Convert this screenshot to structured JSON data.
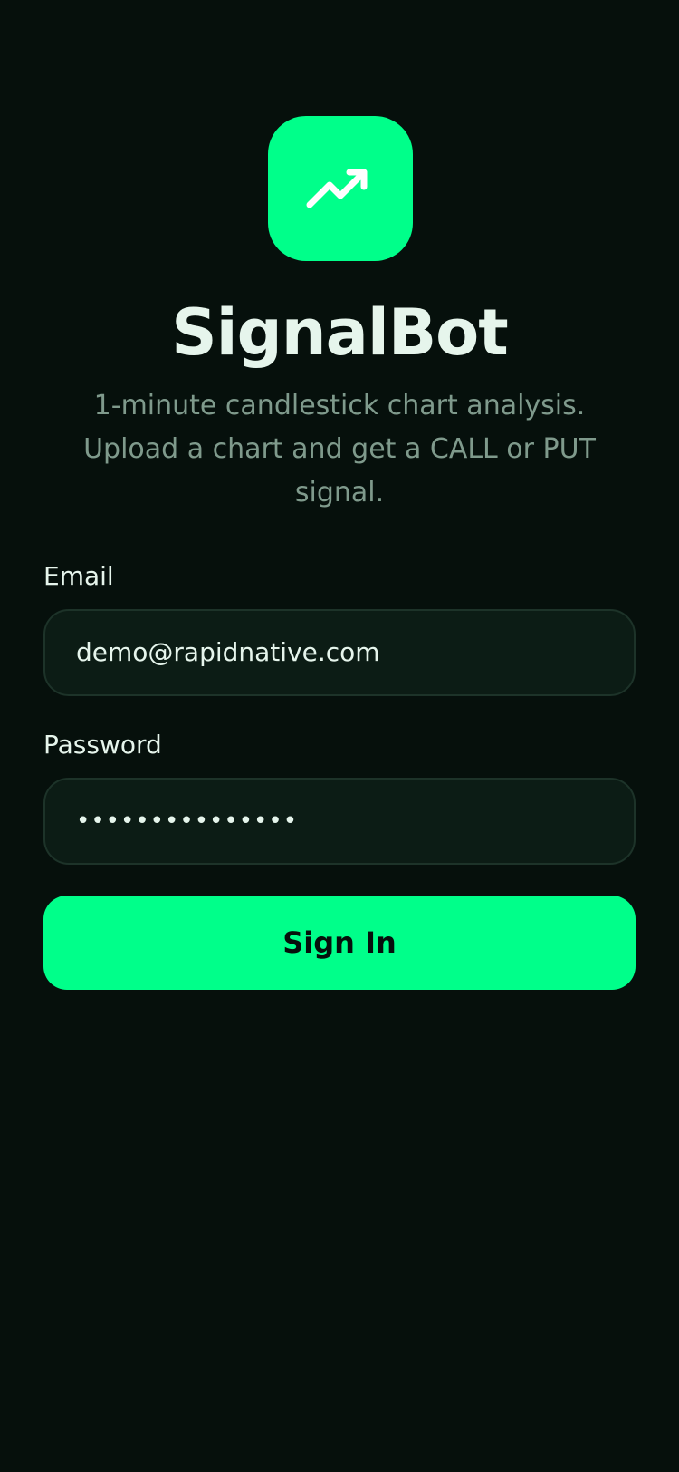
{
  "app": {
    "title": "SignalBot",
    "subtitle": "1-minute candlestick chart analysis. Upload a chart and get a CALL or PUT signal.",
    "logo_icon": "trending-up-icon"
  },
  "form": {
    "email_label": "Email",
    "email_value": "demo@rapidnative.com",
    "password_label": "Password",
    "password_masked": "•••••••••••••••",
    "submit_label": "Sign In"
  },
  "colors": {
    "background": "#06100c",
    "accent": "#00ff8a",
    "input_background": "#0c1c15",
    "input_border": "#1d3329",
    "text_primary": "#e6f5ec",
    "text_secondary": "#7f9a8c"
  }
}
